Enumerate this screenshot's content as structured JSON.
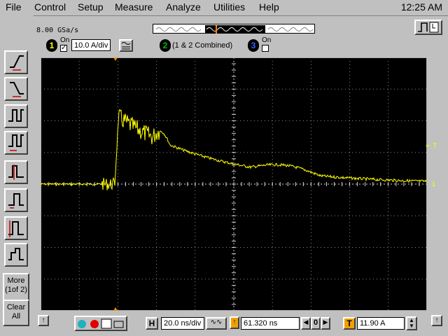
{
  "menu": {
    "items": [
      {
        "label": "File"
      },
      {
        "label": "Control"
      },
      {
        "label": "Setup"
      },
      {
        "label": "Measure"
      },
      {
        "label": "Analyze"
      },
      {
        "label": "Utilities"
      },
      {
        "label": "Help"
      }
    ],
    "clock": "12:25 AM"
  },
  "acquisition": {
    "sample_rate": "8.00 GSa/s"
  },
  "channels": {
    "ch1": {
      "number": "1",
      "on_label": "On",
      "checked": true,
      "scale": "10.0 A/div",
      "color": "#ffff00"
    },
    "ch2": {
      "number": "2",
      "description": "(1 & 2 Combined)",
      "color": "#00c000"
    },
    "ch3": {
      "number": "3",
      "on_label": "On",
      "checked": false,
      "color": "#3060ff"
    }
  },
  "side_buttons": {
    "more": "More\n(1of 2)",
    "clear": "Clear\nAll"
  },
  "screen": {
    "trigger_marker": "← T",
    "ground_marker": "1"
  },
  "horizontal": {
    "label": "H",
    "timebase": "20.0 ns/div",
    "position": "61.320 ns"
  },
  "trigger": {
    "label": "T",
    "level": "11.90 A"
  },
  "nav": {
    "value": "0"
  },
  "trace_color": "#ffff00",
  "grid_color": "#8a8a8a"
}
